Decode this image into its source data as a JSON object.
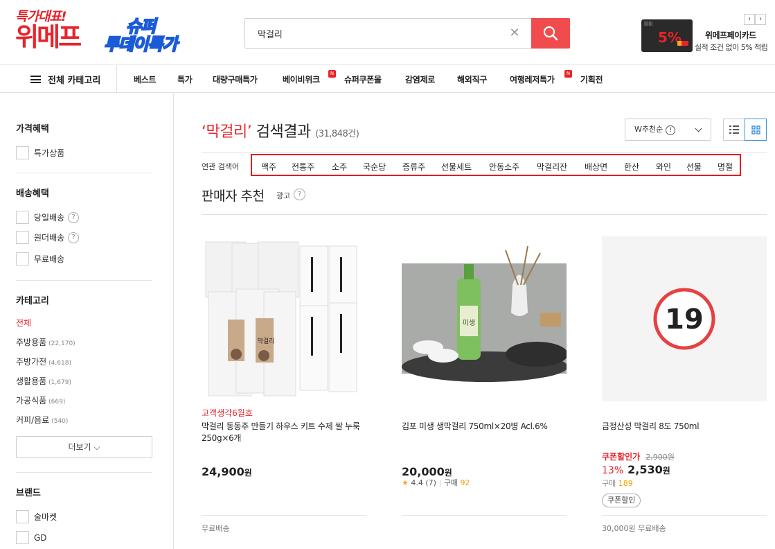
{
  "header": {
    "logo_tag": "특가대표!",
    "logo_brand": "위메프",
    "super_line1": "슈퍼",
    "super_line2": "투데이특가",
    "search_value": "막걸리",
    "card_title": "위메프페이카드",
    "card_sub": "실적 조건 없이 5% 적립",
    "card_pct": "5%"
  },
  "nav": {
    "all_category": "전체 카테고리",
    "items": [
      "베스트",
      "특가",
      "대량구매특가",
      "베이비위크",
      "슈퍼쿠폰몰",
      "감염제로",
      "해외직구",
      "여행레저특가",
      "기획전"
    ],
    "badge": "N"
  },
  "sidebar": {
    "price_title": "가격혜택",
    "price_items": [
      "특가상품"
    ],
    "delivery_title": "배송혜택",
    "delivery_items": [
      "당일배송",
      "원더배송",
      "무료배송"
    ],
    "category_title": "카테고리",
    "categories": [
      {
        "label": "전체",
        "count": ""
      },
      {
        "label": "주방용품",
        "count": "(22,170)"
      },
      {
        "label": "주방가전",
        "count": "(4,618)"
      },
      {
        "label": "생활용품",
        "count": "(1,679)"
      },
      {
        "label": "가공식품",
        "count": "(669)"
      },
      {
        "label": "커피/음료",
        "count": "(540)"
      }
    ],
    "more": "더보기",
    "brand_title": "브랜드",
    "brands": [
      "술마켓",
      "GD"
    ]
  },
  "main": {
    "keyword": "‘막걸리’",
    "result_suffix": " 검색결과",
    "result_count": "(31,848건)",
    "sort_label": "W추천순",
    "related_label": "연관 검색어",
    "related": [
      "맥주",
      "전통주",
      "소주",
      "국순당",
      "증류주",
      "선물세트",
      "안동소주",
      "막걸리잔",
      "배상면",
      "한산",
      "와인",
      "선물",
      "명절"
    ],
    "seller_title": "판매자 추천",
    "ad_label": "광고",
    "adult_badge": "19"
  },
  "products": [
    {
      "tag": "고객생각6월호",
      "name": "막걸리 동동주 만들기 하우스 키트 수제 쌀 누룩 250g×6개",
      "price": "24,900",
      "won": "원",
      "ship": "무료배송",
      "bag_label": "막걸리"
    },
    {
      "name": "김포 미생 생막걸리 750ml×20병 Acl.6%",
      "price": "20,000",
      "won": "원",
      "rating": "4.4",
      "reviews": "(7)",
      "buy_label": "구매",
      "buy_count": "92",
      "bottle_label": "미생"
    },
    {
      "name": "금정산성 막걸리 8도 750ml",
      "coupon_label": "쿠폰할인가",
      "orig_price": "2,900원",
      "discount": "13%",
      "price": "2,530",
      "won": "원",
      "buy_label": "구매",
      "buy_count": "189",
      "badge": "쿠폰할인",
      "ship": "30,000원 무료배송"
    }
  ],
  "colors": {
    "accent": "#e8242a",
    "search_btn": "#f04c4e",
    "highlight_box": "#e8121a"
  }
}
